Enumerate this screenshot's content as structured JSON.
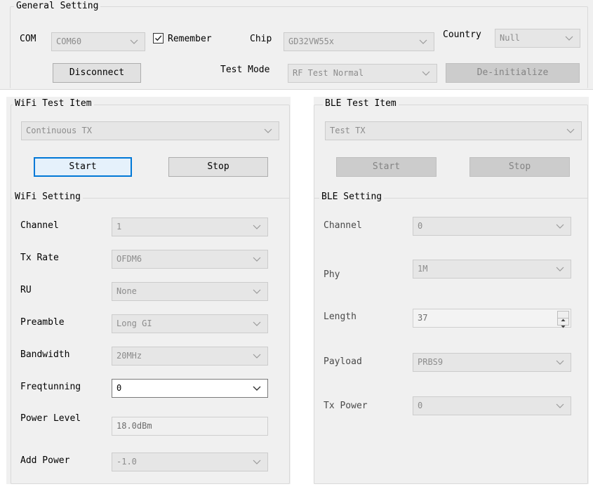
{
  "general": {
    "title": "General Setting",
    "com_label": "COM",
    "com_value": "COM60",
    "remember_label": "Remember",
    "remember_checked": true,
    "chip_label": "Chip",
    "chip_value": "GD32VW55x",
    "country_label": "Country",
    "country_value": "Null",
    "disconnect_label": "Disconnect",
    "test_mode_label": "Test Mode",
    "test_mode_value": "RF Test Normal",
    "deinit_label": "De-initialize"
  },
  "wifi_test": {
    "title": "WiFi Test Item",
    "item_value": "Continuous TX",
    "start_label": "Start",
    "stop_label": "Stop"
  },
  "wifi_setting": {
    "title": "WiFi Setting",
    "rows": [
      {
        "label": "Channel",
        "value": "1",
        "kind": "combo"
      },
      {
        "label": "Tx Rate",
        "value": "OFDM6",
        "kind": "combo"
      },
      {
        "label": "RU",
        "value": "None",
        "kind": "combo"
      },
      {
        "label": "Preamble",
        "value": "Long GI",
        "kind": "combo"
      },
      {
        "label": "Bandwidth",
        "value": "20MHz",
        "kind": "combo"
      },
      {
        "label": "Freqtunning",
        "value": "0",
        "kind": "combo-active"
      },
      {
        "label": "Power Level",
        "value": "18.0dBm",
        "kind": "text"
      },
      {
        "label": "Add Power",
        "value": "-1.0",
        "kind": "combo"
      }
    ]
  },
  "ble_test": {
    "title": "BLE Test Item",
    "item_value": "Test TX",
    "start_label": "Start",
    "stop_label": "Stop"
  },
  "ble_setting": {
    "title": "BLE Setting",
    "rows": [
      {
        "label": "Channel",
        "value": "0",
        "kind": "combo"
      },
      {
        "label": "Phy",
        "value": "1M",
        "kind": "combo"
      },
      {
        "label": "Length",
        "value": "37",
        "kind": "spin"
      },
      {
        "label": "Payload",
        "value": "PRBS9",
        "kind": "combo"
      },
      {
        "label": "Tx Power",
        "value": "0",
        "kind": "combo"
      }
    ]
  },
  "icons": {
    "dropdown": "chevron-down-icon",
    "check": "checkmark-icon",
    "spin_up": "spin-up-icon",
    "spin_down": "spin-down-icon"
  },
  "colors": {
    "panel_bg": "#f0f0f0",
    "disabled_field": "#e6e6e6",
    "focus_accent": "#0078d7"
  }
}
